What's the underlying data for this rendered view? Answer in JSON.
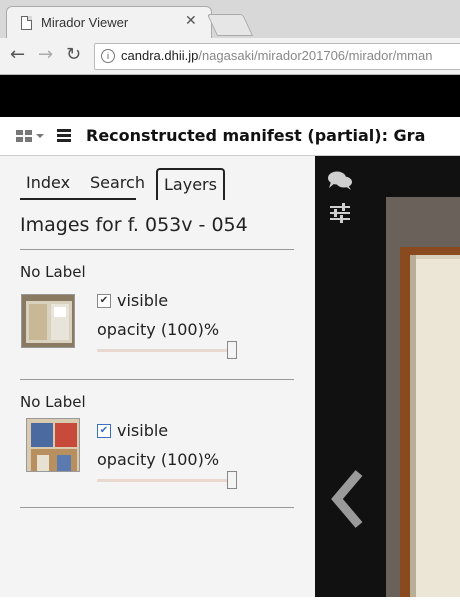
{
  "browser": {
    "tab_title": "Mirador Viewer",
    "tab_close": "✕",
    "url_host": "candra.dhii.jp",
    "url_path": "/nagasaki/mirador201706/mirador/mman",
    "url_icon": "i",
    "nav": {
      "back": "←",
      "forward": "→",
      "reload": "↻"
    }
  },
  "header": {
    "manifest_title": "Reconstructed manifest (partial): Gra"
  },
  "panel": {
    "tabs": [
      "Index",
      "Search",
      "Layers"
    ],
    "active_tab": "Layers",
    "images_heading": "Images for f. 053v - 054",
    "layers": [
      {
        "label": "No Label",
        "visible_label": "visible",
        "visible": true,
        "opacity_text": "opacity (100)%",
        "opacity": 1.0
      },
      {
        "label": "No Label",
        "visible_label": "visible",
        "visible": true,
        "opacity_text": "opacity (100)%",
        "opacity": 1.0
      }
    ]
  },
  "icons": {
    "check": "✔",
    "comments": "comments-icon",
    "sliders": "sliders-icon",
    "prev": "chevron-left-icon"
  },
  "colors": {
    "accent": "#222222",
    "viewer_bg": "#111111",
    "panel_bg": "#f4f4f4"
  }
}
